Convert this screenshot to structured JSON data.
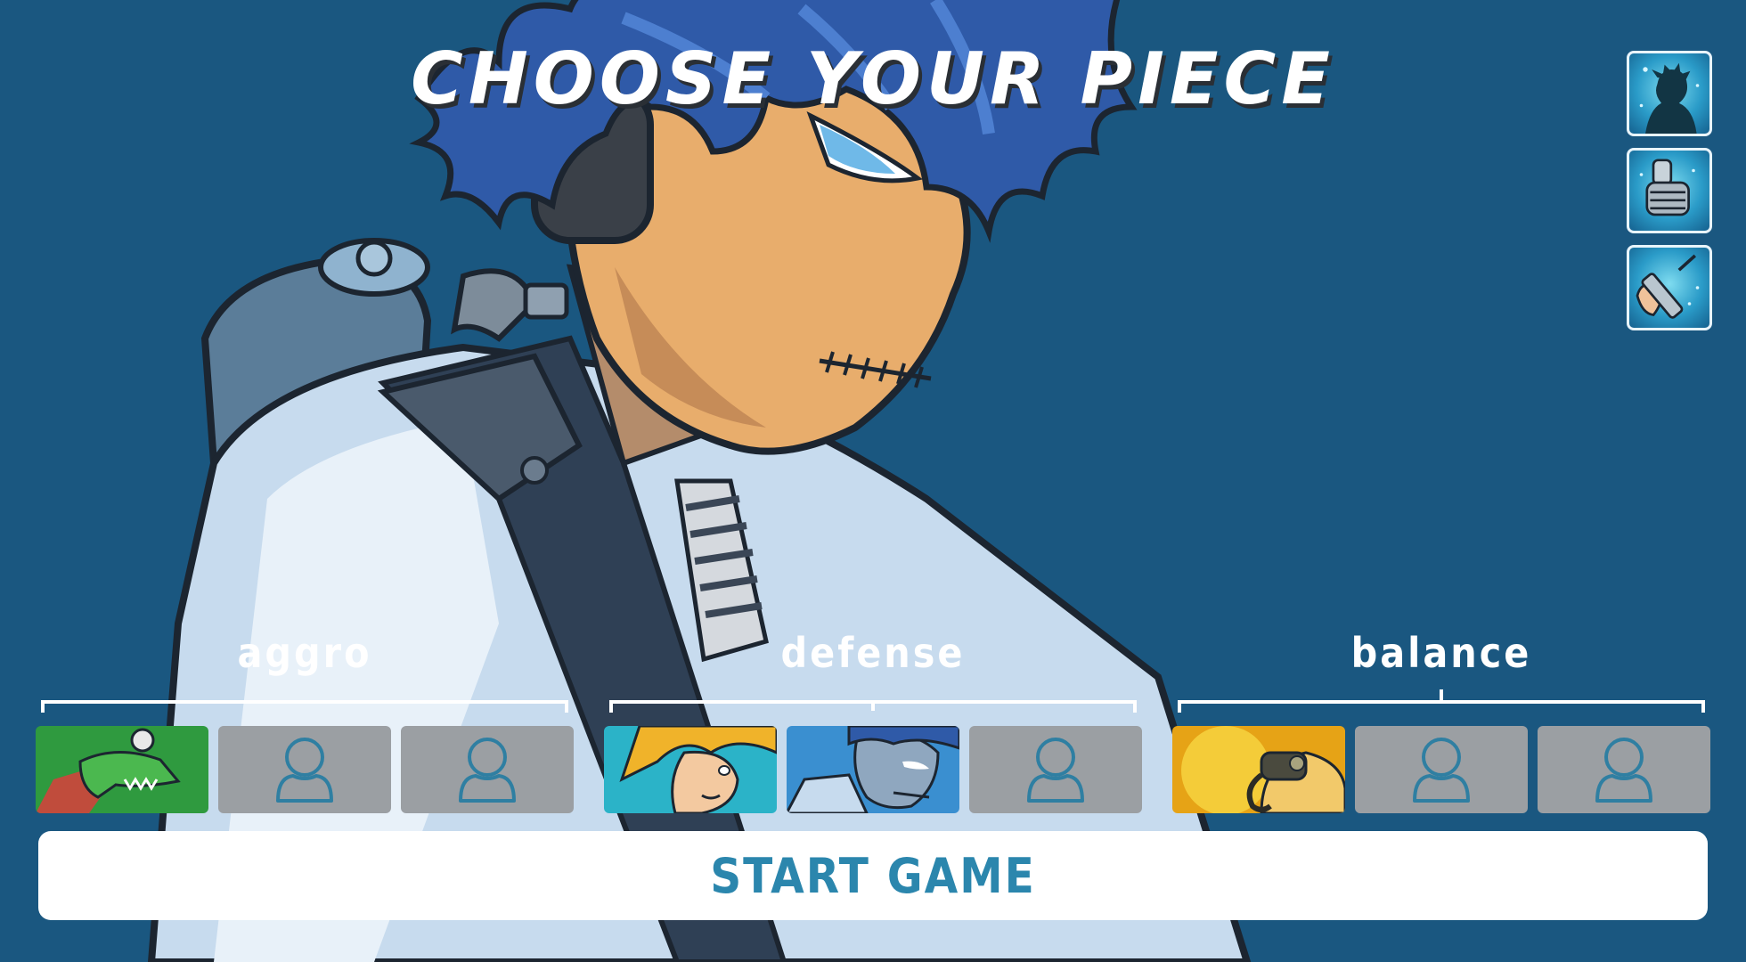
{
  "screen": {
    "title": "CHOOSE YOUR PIECE",
    "background_color": "#1a5780"
  },
  "hero": {
    "icon": "selected-piece-portrait"
  },
  "abilities": [
    {
      "icon": "shadow-figure-icon"
    },
    {
      "icon": "robot-fist-icon"
    },
    {
      "icon": "hand-syringe-icon"
    }
  ],
  "groups": [
    {
      "label": "aggro",
      "slots": [
        {
          "state": "filled",
          "icon": "green-crocodile-portrait"
        },
        {
          "state": "empty",
          "icon": "user-placeholder-icon"
        },
        {
          "state": "empty",
          "icon": "user-placeholder-icon"
        }
      ]
    },
    {
      "label": "defense",
      "slots": [
        {
          "state": "filled",
          "icon": "blonde-girl-portrait"
        },
        {
          "state": "filled",
          "icon": "blue-haired-scientist-portrait"
        },
        {
          "state": "empty",
          "icon": "user-placeholder-icon"
        }
      ]
    },
    {
      "label": "balance",
      "slots": [
        {
          "state": "filled",
          "icon": "gas-mask-yellow-portrait"
        },
        {
          "state": "empty",
          "icon": "user-placeholder-icon"
        },
        {
          "state": "empty",
          "icon": "user-placeholder-icon"
        }
      ]
    }
  ],
  "start_button": {
    "label": "START GAME",
    "text_color": "#2b86ad"
  },
  "colors": {
    "empty_slot": "#9b9fa3",
    "placeholder_stroke": "#2f7fa2",
    "bracket": "#ffffff"
  }
}
